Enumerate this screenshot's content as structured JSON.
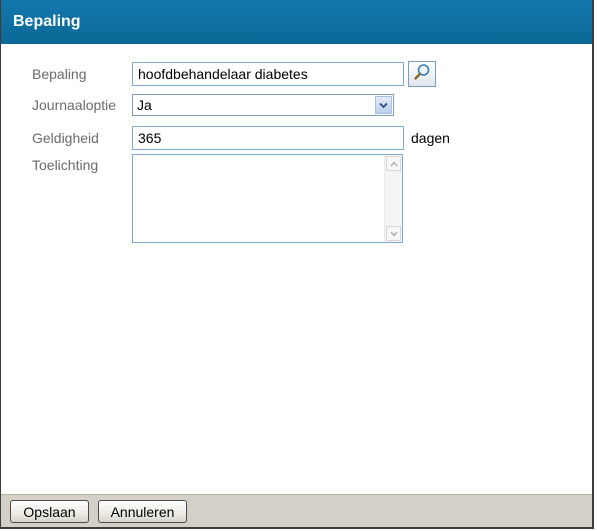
{
  "window": {
    "title": "Bepaling"
  },
  "form": {
    "bepaling": {
      "label": "Bepaling",
      "value": "hoofdbehandelaar diabetes"
    },
    "journaaloptie": {
      "label": "Journaaloptie",
      "value": "Ja"
    },
    "geldigheid": {
      "label": "Geldigheid",
      "value": "365",
      "unit": "dagen"
    },
    "toelichting": {
      "label": "Toelichting",
      "value": ""
    }
  },
  "footer": {
    "save_label": "Opslaan",
    "cancel_label": "Annuleren"
  },
  "icons": {
    "lookup": "magnifier-icon",
    "dropdown": "chevron-down-icon",
    "scroll_up": "scroll-up-arrow-icon",
    "scroll_down": "scroll-down-arrow-icon"
  },
  "colors": {
    "titlebar": "#0a6b9c",
    "field_border": "#7fa9cc",
    "footer": "#d4d0c8"
  }
}
